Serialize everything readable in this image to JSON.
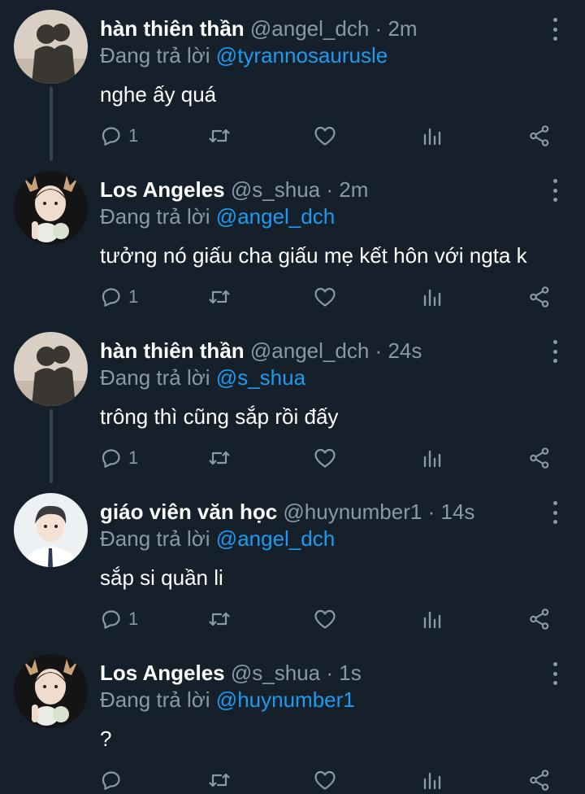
{
  "labels": {
    "replying_to": "Đang trả lời"
  },
  "tweets": [
    {
      "display_name": "hàn thiên thần",
      "handle": "@angel_dch",
      "separator": "·",
      "time": "2m",
      "mention": "@tyrannosaurusle",
      "text": "nghe ấy quá",
      "reply_count": "1",
      "avatar": "shadow-photo"
    },
    {
      "display_name": "Los Angeles",
      "handle": "@s_shua",
      "separator": "·",
      "time": "2m",
      "mention": "@angel_dch",
      "text": "tưởng nó giấu cha giấu mẹ kết hôn với ngta k",
      "reply_count": "1",
      "avatar": "deer-portrait"
    },
    {
      "display_name": "hàn thiên thần",
      "handle": "@angel_dch",
      "separator": "·",
      "time": "24s",
      "mention": "@s_shua",
      "text": "trông thì cũng sắp rồi đấy",
      "reply_count": "1",
      "avatar": "shadow-photo"
    },
    {
      "display_name": "giáo viên văn học",
      "handle": "@huynumber1",
      "separator": "·",
      "time": "14s",
      "mention": "@angel_dch",
      "text": "sắp si quần li",
      "reply_count": "1",
      "avatar": "student-portrait"
    },
    {
      "display_name": "Los Angeles",
      "handle": "@s_shua",
      "separator": "·",
      "time": "1s",
      "mention": "@huynumber1",
      "text": "?",
      "reply_count": "",
      "avatar": "deer-portrait"
    }
  ],
  "icons": {
    "reply": "reply-icon",
    "retweet": "retweet-icon",
    "like": "heart-icon",
    "stats": "stats-icon",
    "share": "share-icon",
    "more": "more-icon"
  },
  "colors": {
    "background": "#15202b",
    "mention": "#1d9bf0",
    "secondary_text": "#8b98a5",
    "thread_line": "#38444d"
  }
}
